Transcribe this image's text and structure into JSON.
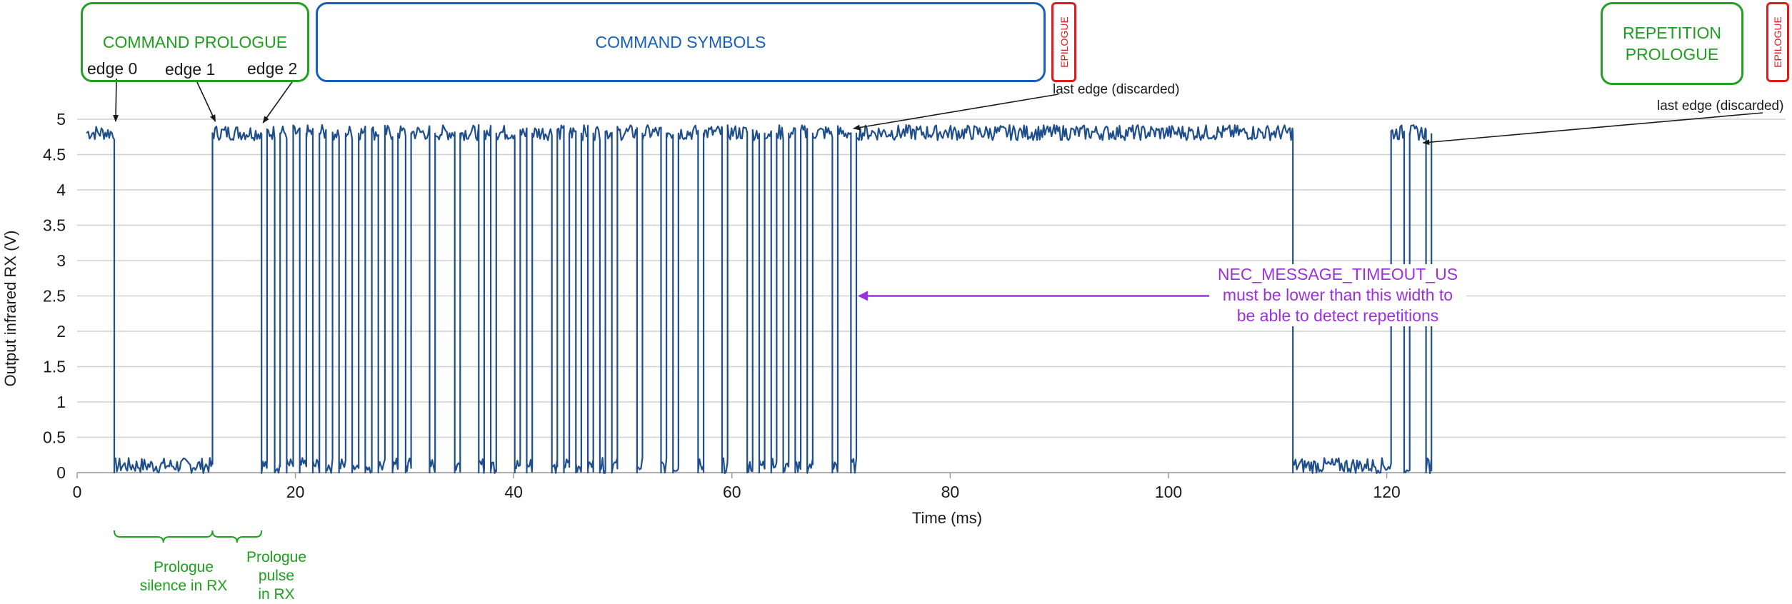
{
  "annotations": {
    "command_prologue": "COMMAND PROLOGUE",
    "command_symbols": "COMMAND SYMBOLS",
    "epilogue": "EPILOGUE",
    "repetition_prologue": "REPETITION\nPROLOGUE",
    "edge_0": "edge 0",
    "edge_1": "edge 1",
    "edge_2": "edge 2",
    "last_edge": "last edge (discarded)",
    "timeout_note": "NEC_MESSAGE_TIMEOUT_US\nmust be lower than this width to\nbe able to detect repetitions",
    "prologue_silence": "Prologue\nsilence in RX",
    "prologue_pulse": "Prologue\npulse\nin RX"
  },
  "colors": {
    "signal": "#1f4e8c",
    "prologue_green": "#22a022",
    "symbols_blue": "#1560bd",
    "epilogue_red": "#e01b1b",
    "timeout_purple": "#9b30e0",
    "grid": "#d0d0d0"
  },
  "chart_data": {
    "type": "line",
    "title": "",
    "xlabel": "Time (ms)",
    "ylabel": "Output infrared RX (V)",
    "xlim": [
      0,
      125
    ],
    "ylim": [
      0,
      5
    ],
    "x_ticks": [
      0,
      20,
      40,
      60,
      80,
      100,
      120
    ],
    "y_ticks": [
      0,
      0.5,
      1,
      1.5,
      2,
      2.5,
      3,
      3.5,
      4,
      4.5,
      5
    ],
    "y_tick_labels": [
      "0",
      "0.5",
      "1",
      "1.5",
      "2",
      "2.5",
      "3",
      "3.5",
      "4",
      "4.5",
      "5"
    ],
    "grid": "horizontal",
    "series": [
      {
        "high_level_v": 4.8,
        "low_level_v": 0.1,
        "initial_level": "high",
        "start_ms": 0.9,
        "end_ms": 124.1,
        "low_intervals_ms": [
          [
            3.4,
            12.4
          ],
          [
            16.9,
            17.4
          ],
          [
            18.1,
            18.6
          ],
          [
            19.2,
            19.8
          ],
          [
            20.4,
            21.0
          ],
          [
            21.6,
            22.2
          ],
          [
            22.8,
            23.4
          ],
          [
            24.0,
            24.6
          ],
          [
            25.2,
            25.8
          ],
          [
            26.4,
            27.0
          ],
          [
            27.6,
            28.2
          ],
          [
            28.9,
            29.4
          ],
          [
            30.1,
            30.6
          ],
          [
            32.3,
            32.8
          ],
          [
            34.6,
            35.1
          ],
          [
            36.8,
            37.3
          ],
          [
            37.9,
            38.4
          ],
          [
            40.1,
            40.6
          ],
          [
            41.2,
            41.7
          ],
          [
            43.5,
            44.0
          ],
          [
            44.6,
            45.1
          ],
          [
            45.7,
            46.2
          ],
          [
            46.8,
            47.3
          ],
          [
            47.9,
            48.4
          ],
          [
            49.0,
            49.5
          ],
          [
            51.3,
            51.8
          ],
          [
            53.5,
            54.0
          ],
          [
            54.6,
            55.1
          ],
          [
            56.9,
            57.4
          ],
          [
            59.1,
            59.6
          ],
          [
            61.4,
            61.9
          ],
          [
            62.5,
            63.0
          ],
          [
            63.6,
            64.1
          ],
          [
            64.7,
            65.2
          ],
          [
            65.8,
            66.3
          ],
          [
            66.9,
            67.4
          ],
          [
            69.2,
            69.7
          ],
          [
            70.9,
            71.4
          ],
          [
            111.4,
            120.4
          ],
          [
            121.6,
            122.1
          ],
          [
            123.6,
            124.1
          ]
        ]
      }
    ],
    "arrow_marker_ms": {
      "edge_0": 3.4,
      "edge_1": 12.4,
      "edge_2": 16.9,
      "last_edge_1": 71.4,
      "last_edge_2": 124.1,
      "timeout_start": 71.4,
      "timeout_end": 111.4,
      "brace_silence": [
        3.4,
        12.4
      ],
      "brace_pulse": [
        12.4,
        16.9
      ]
    }
  }
}
